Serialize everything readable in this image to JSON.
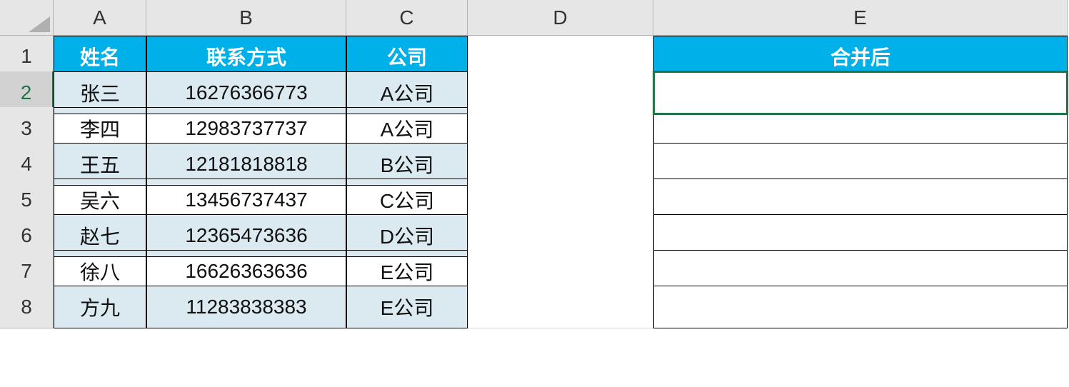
{
  "columns": [
    "A",
    "B",
    "C",
    "D",
    "E"
  ],
  "rows": [
    "1",
    "2",
    "3",
    "4",
    "5",
    "6",
    "7",
    "8"
  ],
  "active_cell": "E2",
  "headers": {
    "A": "姓名",
    "B": "联系方式",
    "C": "公司",
    "E": "合并后"
  },
  "data": [
    {
      "name": "张三",
      "contact": "16276366773",
      "company": "A公司"
    },
    {
      "name": "李四",
      "contact": "12983737737",
      "company": "A公司"
    },
    {
      "name": "王五",
      "contact": "12181818818",
      "company": "B公司"
    },
    {
      "name": "吴六",
      "contact": "13456737437",
      "company": "C公司"
    },
    {
      "name": "赵七",
      "contact": "12365473636",
      "company": "D公司"
    },
    {
      "name": "徐八",
      "contact": "16626363636",
      "company": "E公司"
    },
    {
      "name": "方九",
      "contact": "11283838383",
      "company": "E公司"
    }
  ]
}
